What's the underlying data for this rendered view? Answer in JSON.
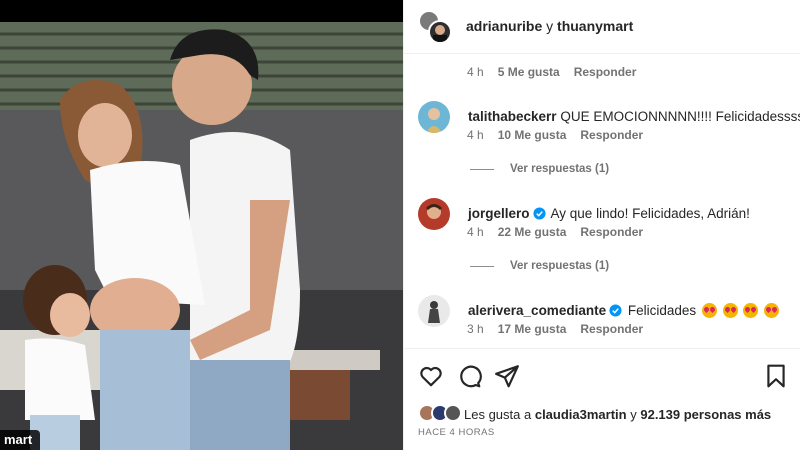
{
  "photo": {
    "tag": "mart"
  },
  "header": {
    "user1": "adrianuribe",
    "connector": "y",
    "user2": "thuanymart"
  },
  "top_meta": {
    "time": "4 h",
    "likes": "5 Me gusta",
    "reply": "Responder"
  },
  "comments": [
    {
      "user": "talithabeckerr",
      "text": "QUE EMOCIONNNNN!!!! Felicidadessss",
      "verified": false,
      "time": "4 h",
      "likes": "10 Me gusta",
      "reply": "Responder",
      "view_replies": "Ver respuestas (1)"
    },
    {
      "user": "jorgellero",
      "text": "Ay que lindo! Felicidades, Adrián!",
      "verified": true,
      "time": "4 h",
      "likes": "22 Me gusta",
      "reply": "Responder",
      "view_replies": "Ver respuestas (1)"
    },
    {
      "user": "alerivera_comediante",
      "text": "Felicidades",
      "verified": true,
      "emoji": "star-struck-emoji",
      "emoji_count": 4,
      "time": "3 h",
      "likes": "17 Me gusta",
      "reply": "Responder"
    }
  ],
  "actions": {
    "icons": [
      "heart-icon",
      "comment-icon",
      "share-icon",
      "bookmark-icon"
    ]
  },
  "likes_summary": {
    "prefix": "Les gusta a",
    "user": "claudia3martin",
    "connector": "y",
    "count": "92.139 personas más"
  },
  "posted": "HACE 4 HORAS",
  "colors": {
    "text": "#262626",
    "secondary": "#737373",
    "verified": "#0095f6",
    "border": "#efefef"
  }
}
